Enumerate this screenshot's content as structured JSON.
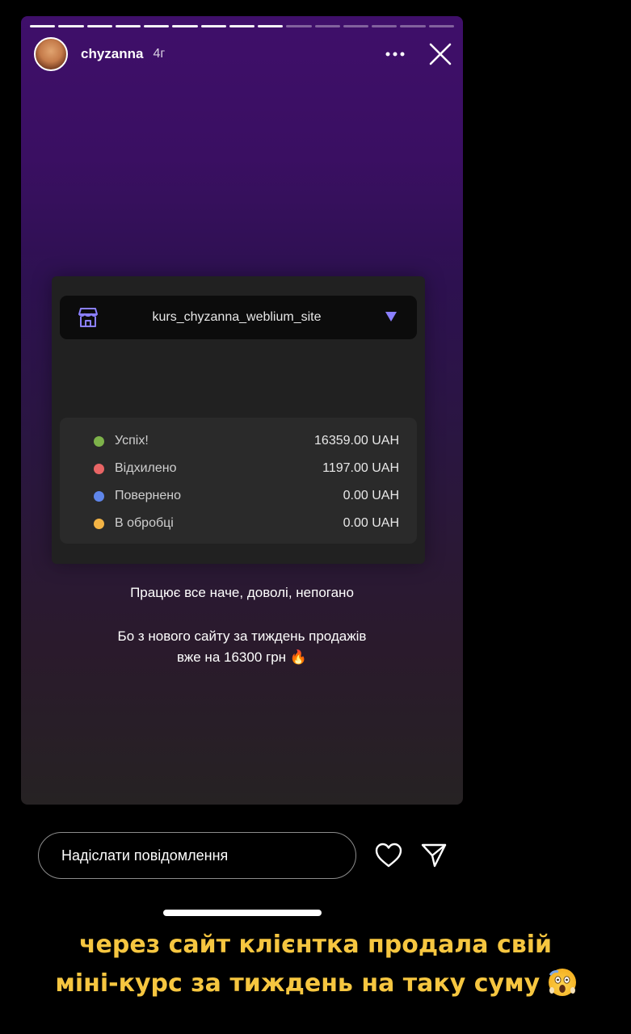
{
  "story": {
    "username": "chyzanna",
    "time": "4г",
    "segments_total": 15,
    "segments_done": 9
  },
  "card": {
    "site_name": "kurs_chyzanna_weblium_site",
    "stats": [
      {
        "label": "Успіх!",
        "value": "16359.00 UAH",
        "color": "#7db24a"
      },
      {
        "label": "Відхилено",
        "value": "1197.00 UAH",
        "color": "#e86565"
      },
      {
        "label": "Повернено",
        "value": "0.00 UAH",
        "color": "#5f86ea"
      },
      {
        "label": "В обробці",
        "value": "0.00 UAH",
        "color": "#f3b445"
      }
    ]
  },
  "captions": {
    "line1": "Працює все наче, доволі, непогано",
    "line2a": "Бо з нового сайту за тиждень продажів",
    "line2b": "вже на 16300 грн 🔥"
  },
  "reply": {
    "placeholder": "Надіслати повідомлення"
  },
  "overlay": {
    "line1": "через сайт клієнтка продала свій",
    "line2": "міні-курс за тиждень на таку суму"
  },
  "icons": [
    "more-icon",
    "close-icon",
    "store-icon",
    "caret-down-icon",
    "heart-icon",
    "send-icon",
    "scream-emoji-icon"
  ]
}
